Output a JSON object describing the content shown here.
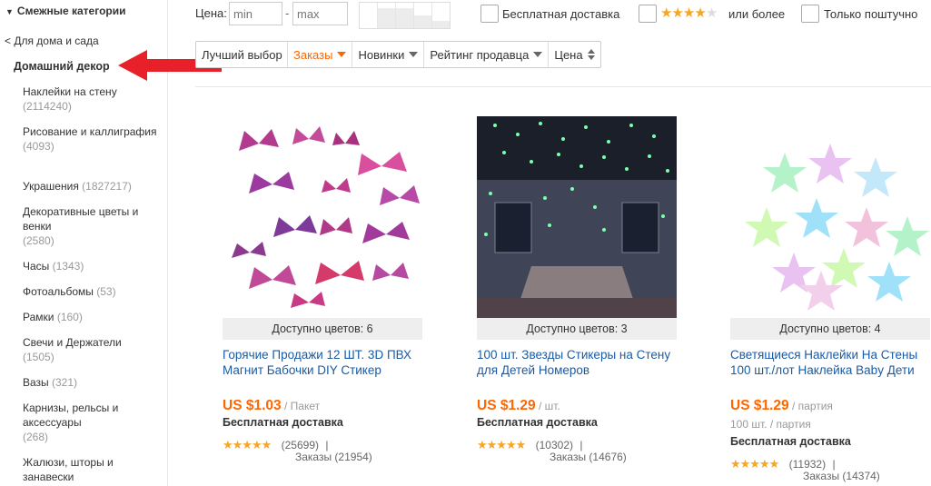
{
  "sidebar": {
    "header": "Смежные категории",
    "back": "< Для дома и сада",
    "current": "Домашний декор",
    "items": [
      {
        "name": "Наклейки на стену",
        "count": "(2114240)"
      },
      {
        "name": "Рисование и каллиграфия",
        "count": "(4093)"
      },
      {
        "name": "Украшения",
        "count": "(1827217)"
      },
      {
        "name": "Декоративные цветы и венки",
        "count": "(2580)"
      },
      {
        "name": "Часы",
        "count": "(1343)"
      },
      {
        "name": "Фотоальбомы",
        "count": "(53)"
      },
      {
        "name": "Рамки",
        "count": "(160)"
      },
      {
        "name": "Свечи и Держатели",
        "count": "(1505)"
      },
      {
        "name": "Вазы",
        "count": "(321)"
      },
      {
        "name": "Карнизы, рельсы и аксессуары",
        "count": "(268)"
      },
      {
        "name": "Жалюзи, шторы и занавески",
        "count": ""
      }
    ]
  },
  "filters": {
    "price_label": "Цена:",
    "min_placeholder": "min",
    "max_placeholder": "max",
    "dash": "-",
    "free_shipping": "Бесплатная доставка",
    "rating_suffix": "или более",
    "rating_stars": 4,
    "single_piece": "Только поштучно"
  },
  "sort": {
    "tabs": [
      "Лучший выбор",
      "Заказы",
      "Новинки",
      "Рейтинг продавца",
      "Цена"
    ],
    "active": "Заказы"
  },
  "colors": {
    "accent": "#ff6600",
    "link": "#1a5ba6",
    "star": "#f5a623",
    "arrow": "#e8202a"
  },
  "products": [
    {
      "colors": "Доступно цветов: 6",
      "title": "Горячие Продажи 12 ШТ. 3D ПВХ Магнит Бабочки DIY Стикер",
      "price": "US $1.03",
      "unit": "/ Пакет",
      "sub": "",
      "shipping": "Бесплатная доставка",
      "rating": "★★★★★",
      "reviews": "(25699)",
      "sep": "|",
      "orders": "Заказы (21954)"
    },
    {
      "colors": "Доступно цветов: 3",
      "title": "100 шт. Звезды Стикеры на Стену для Детей Номеров",
      "price": "US $1.29",
      "unit": "/ шт.",
      "sub": "",
      "shipping": "Бесплатная доставка",
      "rating": "★★★★★",
      "reviews": "(10302)",
      "sep": "|",
      "orders": "Заказы (14676)"
    },
    {
      "colors": "Доступно цветов: 4",
      "title": "Светящиеся Наклейки На Стены 100 шт./лот Наклейка Baby Дети",
      "price": "US $1.29",
      "unit": "/ партия",
      "sub": "100 шт. / партия",
      "shipping": "Бесплатная доставка",
      "rating": "★★★★★",
      "reviews": "(11932)",
      "sep": "|",
      "orders": "Заказы (14374)"
    }
  ]
}
